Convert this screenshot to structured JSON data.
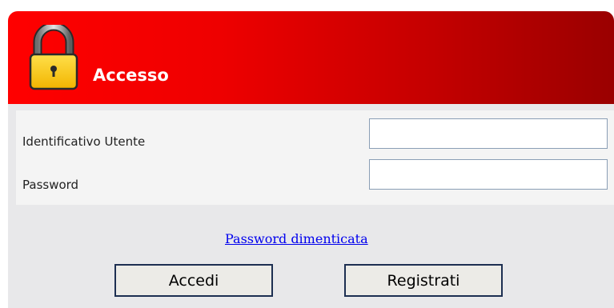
{
  "header": {
    "title": "Accesso",
    "icon": "padlock-icon",
    "gradient_start": "#ff0000",
    "gradient_end": "#9a0000"
  },
  "form": {
    "username_label": "Identificativo Utente",
    "username_value": "",
    "password_label": "Password",
    "password_value": ""
  },
  "links": {
    "forgot_password": "Password dimenticata"
  },
  "buttons": {
    "login": "Accedi",
    "register": "Registrati"
  }
}
